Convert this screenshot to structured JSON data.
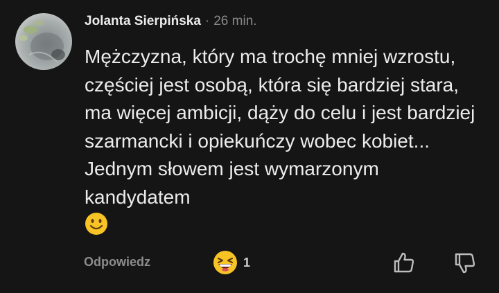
{
  "comment": {
    "author": "Jolanta Sierpińska",
    "separator": "·",
    "time": "26 min.",
    "text": "Mężczyzna, który ma trochę mniej wzrostu, częściej jest osobą, która się bardziej stara, ma więcej ambicji, dąży do celu i jest bardziej szarmancki i opiekuńczy wobec kobiet... Jednym słowem jest wymarzonym kandydatem",
    "emoji_icon": "slightly-smiling-face-icon"
  },
  "footer": {
    "reply_label": "Odpowiedz",
    "reaction_icon": "grinning-squinting-face-icon",
    "reaction_count": "1",
    "like_icon": "thumbs-up-icon",
    "dislike_icon": "thumbs-down-icon"
  },
  "colors": {
    "background": "#151515",
    "text": "#ececec",
    "muted": "#8a8a8a",
    "emoji_yellow": "#f7c325"
  }
}
